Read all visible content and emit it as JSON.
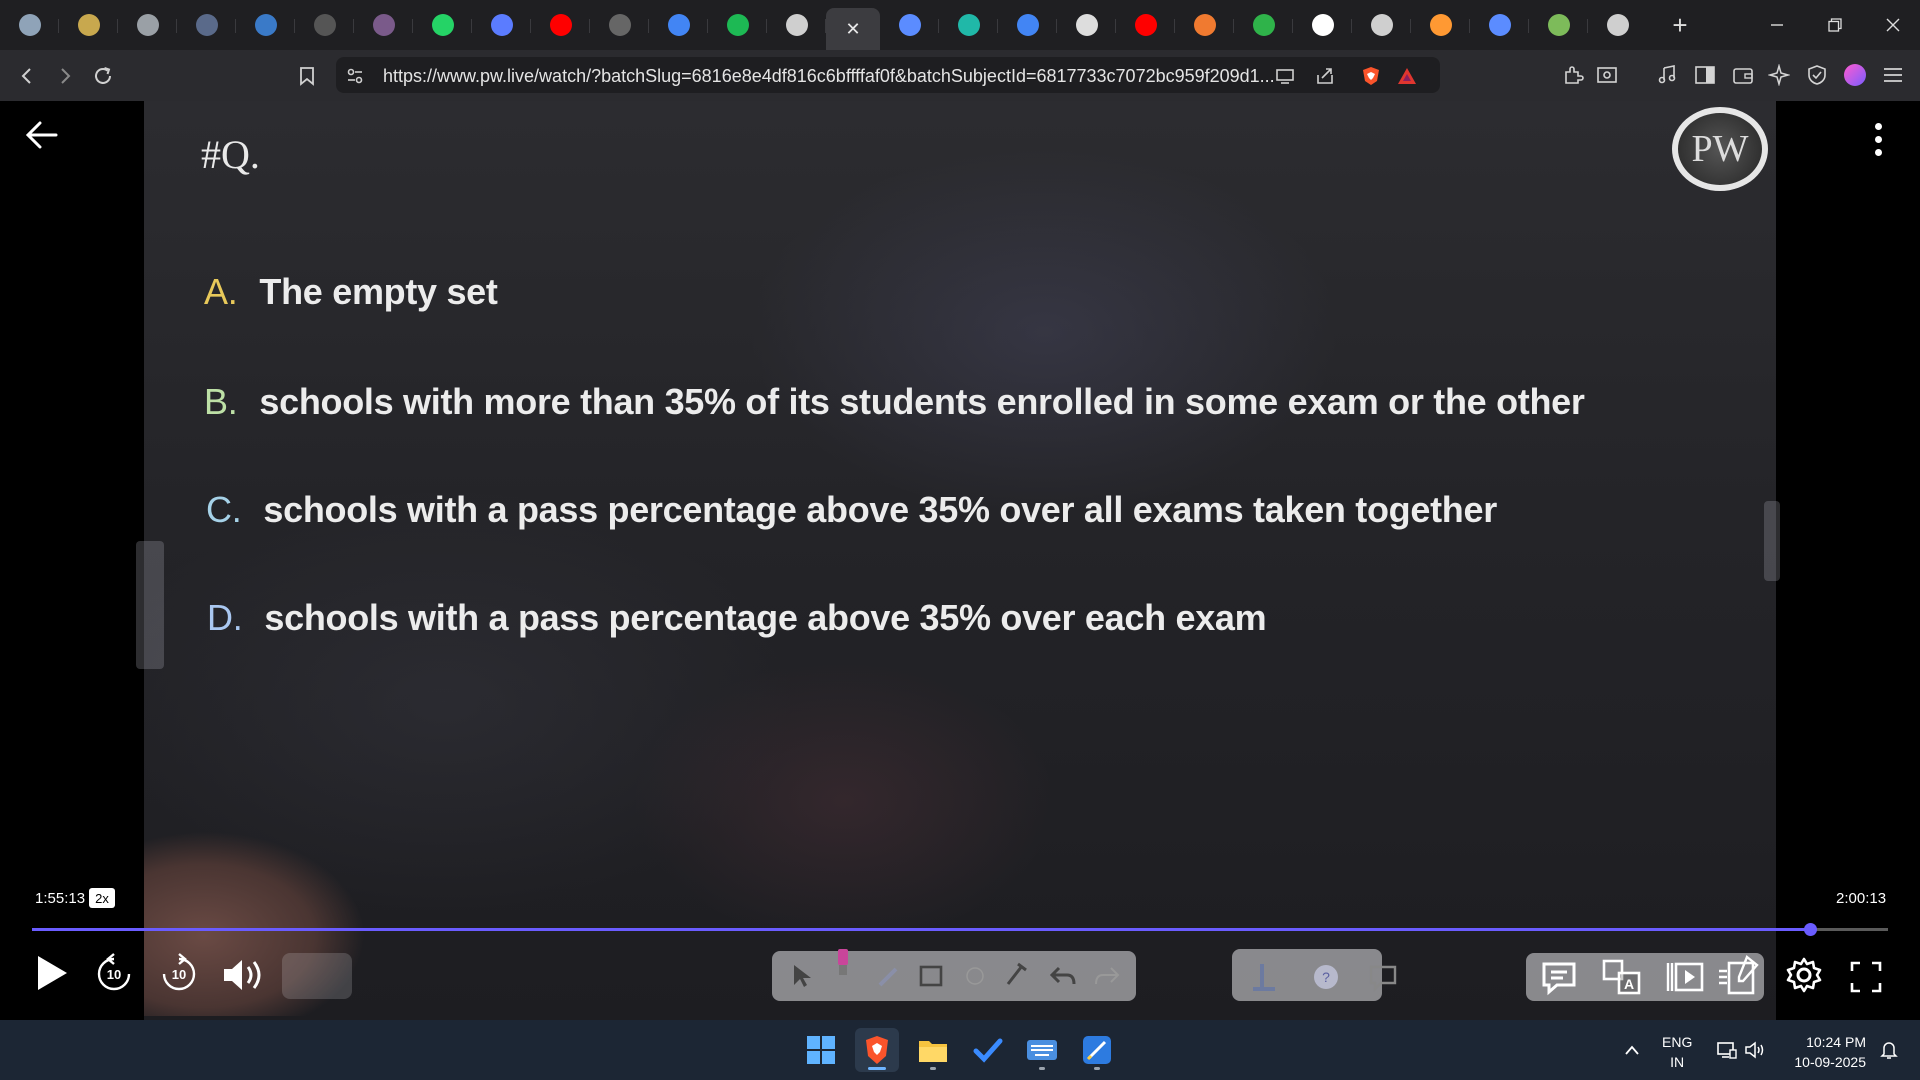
{
  "browser": {
    "tabs": [
      {
        "icon": "chat-icon",
        "color": "#8fa3b8"
      },
      {
        "icon": "circle-logo-icon",
        "color": "#c8a84e"
      },
      {
        "icon": "bracket-icon",
        "color": "#9aa0a6"
      },
      {
        "icon": "rose-icon",
        "color": "#5a6a8a"
      },
      {
        "icon": "wordpress-icon",
        "color": "#3a7ac8"
      },
      {
        "icon": "dotted-circle-icon",
        "color": "#555555"
      },
      {
        "icon": "profile-icon",
        "color": "#7a5a8a"
      },
      {
        "icon": "whatsapp-icon",
        "color": "#25d366"
      },
      {
        "icon": "bookmark-app-icon",
        "color": "#5b7cff"
      },
      {
        "icon": "youtube-icon",
        "color": "#ff0000"
      },
      {
        "icon": "e2p-icon",
        "color": "#666666"
      },
      {
        "icon": "google-icon",
        "color": "#4285f4"
      },
      {
        "icon": "spotify-icon",
        "color": "#1db954"
      },
      {
        "icon": "globe-icon",
        "color": "#cfcfcf"
      },
      {
        "icon": "close-tab-icon",
        "active": true
      },
      {
        "icon": "gemini-icon",
        "color": "#5b8cff"
      },
      {
        "icon": "perplexity-icon",
        "color": "#20b8a8"
      },
      {
        "icon": "google-icon",
        "color": "#4285f4"
      },
      {
        "icon": "screen-icon",
        "color": "#dddddd"
      },
      {
        "icon": "youtube-icon",
        "color": "#ff0000"
      },
      {
        "icon": "ball-icon",
        "color": "#f07a30"
      },
      {
        "icon": "leaf-icon",
        "color": "#2fb34a"
      },
      {
        "icon": "wikipedia-icon",
        "color": "#ffffff"
      },
      {
        "icon": "globe-icon",
        "color": "#cfcfcf"
      },
      {
        "icon": "india-flag-icon",
        "color": "#ff9933"
      },
      {
        "icon": "gemini-icon",
        "color": "#5b8cff"
      },
      {
        "icon": "grammarly-icon",
        "color": "#7dbb5a"
      },
      {
        "icon": "globe-icon",
        "color": "#cfcfcf"
      }
    ],
    "new_tab_label": "+",
    "url": "https://www.pw.live/watch/?batchSlug=6816e8e4df816c6bffffaf0f&batchSubjectId=6817733c7072bc959f209d1..."
  },
  "video": {
    "question_label": "#Q.",
    "options": [
      {
        "letter": "A.",
        "text": "The empty set"
      },
      {
        "letter": "B.",
        "text": "schools with more than 35% of its students enrolled in some exam or the other"
      },
      {
        "letter": "C.",
        "text": "schools with a pass percentage above 35% over all exams taken together"
      },
      {
        "letter": "D.",
        "text": "schools with a pass percentage above 35% over each exam"
      }
    ],
    "logo_text": "PW"
  },
  "player": {
    "current_time": "1:55:13",
    "speed": "2x",
    "total_time": "2:00:13",
    "progress_fraction": 0.958,
    "rewind_seconds": "10",
    "forward_seconds": "10",
    "accent": "#6a5cff"
  },
  "taskbar": {
    "lang_primary": "ENG",
    "lang_secondary": "IN",
    "time": "10:24 PM",
    "date": "10-09-2025"
  }
}
